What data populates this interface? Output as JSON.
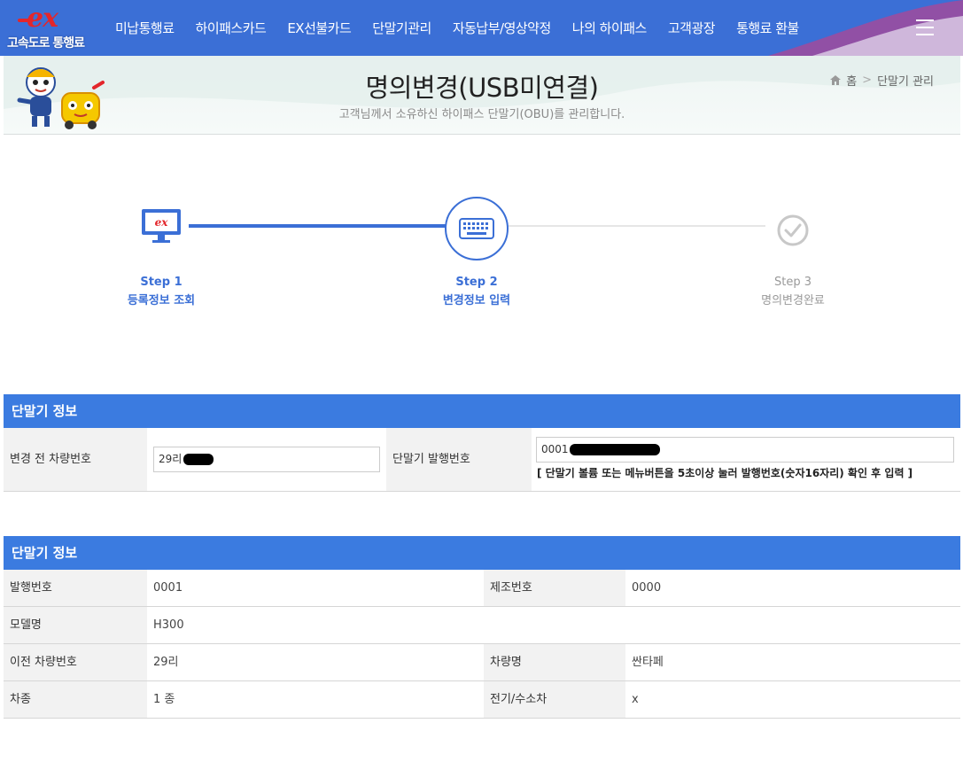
{
  "header": {
    "logo_main": "ex",
    "logo_text": "고속도로 통행료",
    "menu": [
      "미납통행료",
      "하이패스카드",
      "EX선불카드",
      "단말기관리",
      "자동납부/영상약정",
      "나의 하이패스",
      "고객광장",
      "통행료 환불"
    ]
  },
  "banner": {
    "title": "명의변경(USB미연결)",
    "subtitle": "고객님께서 소유하신 하이패스 단말기(OBU)를 관리합니다.",
    "breadcrumb_home": "홈",
    "breadcrumb_current": "단말기 관리"
  },
  "steps": [
    {
      "step": "Step 1",
      "label": "등록정보 조회",
      "state": "done"
    },
    {
      "step": "Step 2",
      "label": "변경정보 입력",
      "state": "current"
    },
    {
      "step": "Step 3",
      "label": "명의변경완료",
      "state": "pending"
    }
  ],
  "form_section": {
    "title": "단말기 정보",
    "prev_plate_label": "변경 전 차량번호",
    "prev_plate_value": "29리",
    "serial_label": "단말기 발행번호",
    "serial_value": "0001",
    "help": "[ 단말기 볼륨 또는 메뉴버튼을 5초이상 눌러 발행번호(숫자16자리) 확인 후 입력 ]"
  },
  "info_section": {
    "title": "단말기 정보",
    "rows": [
      {
        "label1": "발행번호",
        "value1": "0001",
        "label2": "제조번호",
        "value2": "0000"
      },
      {
        "label1": "모델명",
        "value1": "H300",
        "label2": "",
        "value2": ""
      },
      {
        "label1": "이전 차량번호",
        "value1": "29리",
        "label2": "차량명",
        "value2": "싼타페"
      },
      {
        "label1": "차종",
        "value1": "1 종",
        "label2": "전기/수소차",
        "value2": "x"
      }
    ]
  },
  "colors": {
    "primary": "#3b6fd6",
    "section_header": "#3b7be0",
    "logo_red": "#e3262b"
  }
}
